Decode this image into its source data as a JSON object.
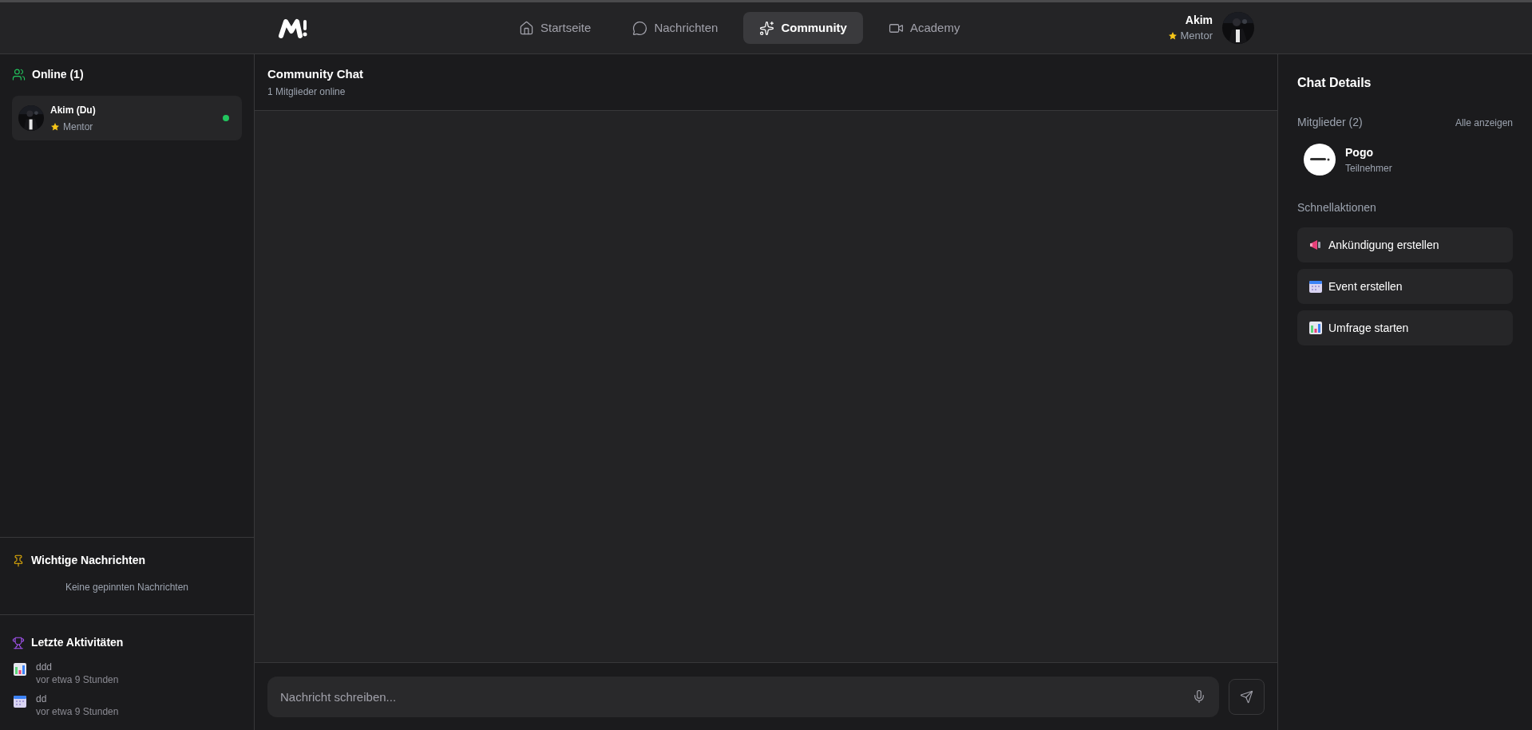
{
  "nav": {
    "items": [
      {
        "label": "Startseite",
        "kind": "home",
        "selected": false
      },
      {
        "label": "Nachrichten",
        "kind": "chat",
        "selected": false
      },
      {
        "label": "Community",
        "kind": "sparkles",
        "selected": true
      },
      {
        "label": "Academy",
        "kind": "video",
        "selected": false
      }
    ]
  },
  "user": {
    "name": "Akim",
    "role": "Mentor"
  },
  "online": {
    "title": "Online (1)",
    "members": [
      {
        "name": "Akim (Du)",
        "role": "Mentor",
        "online": true
      }
    ]
  },
  "pinned": {
    "title": "Wichtige Nachrichten",
    "empty": "Keine gepinnten Nachrichten"
  },
  "activities": {
    "title": "Letzte Aktivitäten",
    "items": [
      {
        "kind": "chart",
        "title": "ddd",
        "time": "vor etwa 9 Stunden"
      },
      {
        "kind": "calendar",
        "title": "dd",
        "time": "vor etwa 9 Stunden"
      }
    ]
  },
  "chat": {
    "title": "Community Chat",
    "subtitle": "1 Mitglieder online",
    "input": {
      "placeholder": "Nachricht schreiben..."
    }
  },
  "details": {
    "title": "Chat Details",
    "members_title": "Mitglieder (2)",
    "show_all": "Alle anzeigen",
    "members": [
      {
        "name": "Pogo",
        "role": "Teilnehmer"
      }
    ],
    "actions_title": "Schnellaktionen",
    "actions": [
      {
        "kind": "megaphone",
        "label": "Ankündigung erstellen"
      },
      {
        "kind": "calendar",
        "label": "Event erstellen"
      },
      {
        "kind": "chart",
        "label": "Umfrage starten"
      }
    ]
  }
}
